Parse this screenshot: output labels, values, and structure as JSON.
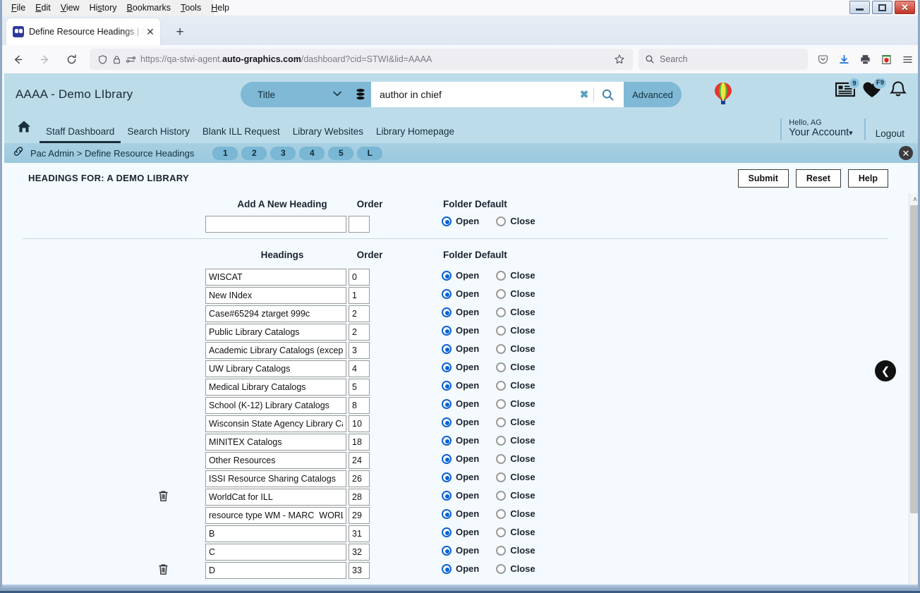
{
  "browser": {
    "menu_items": [
      "File",
      "Edit",
      "View",
      "History",
      "Bookmarks",
      "Tools",
      "Help"
    ],
    "tab_title": "Define Resource Headings | STW",
    "tab_close_glyph": "✕",
    "new_tab_glyph": "+",
    "back_glyph": "←",
    "forward_glyph": "→",
    "reload_glyph": "⟳",
    "url_prefix": "https://qa-stwi-agent.",
    "url_domain": "auto-graphics.com",
    "url_suffix": "/dashboard?cid=STWI&lid=AAAA",
    "search_placeholder": "Search",
    "window_controls": {
      "minimize": "minimize",
      "maximize": "maximize",
      "close": "✕"
    }
  },
  "app": {
    "library_name": "AAAA - Demo LIbrary",
    "search": {
      "scope_label": "Title",
      "scope_chevron": "∨",
      "query_value": "author in chief",
      "clear_glyph": "✖",
      "advanced_label": "Advanced"
    },
    "header_badges": {
      "list_count": "9",
      "favorites_count": "F9"
    },
    "nav_links": [
      "Staff Dashboard",
      "Search History",
      "Blank ILL Request",
      "Library Websites",
      "Library Homepage"
    ],
    "account": {
      "hello": "Hello, AG",
      "your_account": "Your Account",
      "account_chevron": "∨",
      "logout": "Logout"
    },
    "breadcrumb": {
      "text": "Pac Admin > Define Resource Headings",
      "steps": [
        "1",
        "2",
        "3",
        "4",
        "5",
        "L"
      ],
      "close_glyph": "✕"
    },
    "page_title": "HEADINGS FOR: A DEMO LIBRARY",
    "actions": {
      "submit": "Submit",
      "reset": "Reset",
      "help": "Help"
    },
    "add_section": {
      "heading_label": "Add A New Heading",
      "order_label": "Order",
      "folder_label": "Folder Default",
      "heading_value": "",
      "order_value": "",
      "open_label": "Open",
      "close_label": "Close",
      "folder_default": "Open"
    },
    "table": {
      "headings_label": "Headings",
      "order_label": "Order",
      "folder_label": "Folder Default",
      "open_label": "Open",
      "close_label": "Close",
      "rows": [
        {
          "heading": "WISCAT",
          "order": "0",
          "folder_default": "Open",
          "has_delete": false
        },
        {
          "heading": "New INdex",
          "order": "1",
          "folder_default": "Open",
          "has_delete": false
        },
        {
          "heading": "Case#65294 ztarget 999c",
          "order": "2",
          "folder_default": "Open",
          "has_delete": false
        },
        {
          "heading": "Public Library Catalogs",
          "order": "2",
          "folder_default": "Open",
          "has_delete": false
        },
        {
          "heading": "Academic Library Catalogs (except UW)",
          "order": "3",
          "folder_default": "Open",
          "has_delete": false
        },
        {
          "heading": "UW Library Catalogs",
          "order": "4",
          "folder_default": "Open",
          "has_delete": false
        },
        {
          "heading": "Medical Library Catalogs",
          "order": "5",
          "folder_default": "Open",
          "has_delete": false
        },
        {
          "heading": "School (K-12) Library Catalogs",
          "order": "8",
          "folder_default": "Open",
          "has_delete": false
        },
        {
          "heading": "Wisconsin State Agency Library Catalogs",
          "order": "10",
          "folder_default": "Open",
          "has_delete": false
        },
        {
          "heading": "MINITEX Catalogs",
          "order": "18",
          "folder_default": "Open",
          "has_delete": false
        },
        {
          "heading": "Other Resources",
          "order": "24",
          "folder_default": "Open",
          "has_delete": false
        },
        {
          "heading": "ISSI Resource Sharing Catalogs",
          "order": "26",
          "folder_default": "Open",
          "has_delete": false
        },
        {
          "heading": "WorldCat for ILL",
          "order": "28",
          "folder_default": "Open",
          "has_delete": true
        },
        {
          "heading": "resource type WM - MARC  WORLDCAT",
          "order": "29",
          "folder_default": "Open",
          "has_delete": false
        },
        {
          "heading": "B",
          "order": "31",
          "folder_default": "Open",
          "has_delete": false
        },
        {
          "heading": "C",
          "order": "32",
          "folder_default": "Open",
          "has_delete": false
        },
        {
          "heading": "D",
          "order": "33",
          "folder_default": "Open",
          "has_delete": true
        }
      ]
    },
    "collapse_glyph": "❮",
    "scroll_up_glyph": "∧"
  },
  "colors": {
    "header_blue": "#bddcea",
    "accent_blue": "#7fb9d6",
    "crumb_blue": "#9bc8dd",
    "radio_selected": "#0a63d6",
    "page_bg": "#f4fafd"
  }
}
